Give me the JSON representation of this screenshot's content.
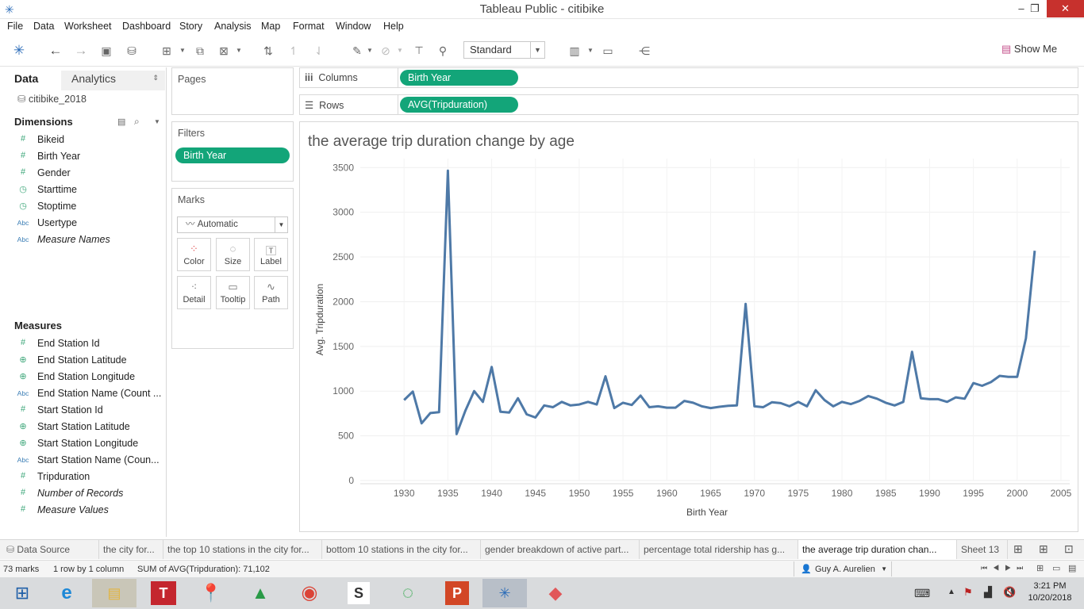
{
  "window": {
    "title": "Tableau Public - citibike"
  },
  "menu": [
    "File",
    "Data",
    "Worksheet",
    "Dashboard",
    "Story",
    "Analysis",
    "Map",
    "Format",
    "Window",
    "Help"
  ],
  "toolbar": {
    "mark_type_select": "Standard",
    "show_me": "Show Me"
  },
  "left_pane": {
    "tabs": [
      "Data",
      "Analytics"
    ],
    "datasource": "citibike_2018",
    "dimensions_header": "Dimensions",
    "dimensions": [
      {
        "label": "Bikeid",
        "icon": "number-icon"
      },
      {
        "label": "Birth Year",
        "icon": "number-icon"
      },
      {
        "label": "Gender",
        "icon": "number-icon"
      },
      {
        "label": "Starttime",
        "icon": "datetime-icon"
      },
      {
        "label": "Stoptime",
        "icon": "datetime-icon"
      },
      {
        "label": "Usertype",
        "icon": "string-icon"
      },
      {
        "label": "Measure Names",
        "icon": "string-icon"
      }
    ],
    "measures_header": "Measures",
    "measures": [
      {
        "label": "End Station Id",
        "icon": "number-icon"
      },
      {
        "label": "End Station Latitude",
        "icon": "globe-icon"
      },
      {
        "label": "End Station Longitude",
        "icon": "globe-icon"
      },
      {
        "label": "End Station Name (Count ...",
        "icon": "string-icon"
      },
      {
        "label": "Start Station Id",
        "icon": "number-icon"
      },
      {
        "label": "Start Station Latitude",
        "icon": "globe-icon"
      },
      {
        "label": "Start Station Longitude",
        "icon": "globe-icon"
      },
      {
        "label": "Start Station Name (Coun...",
        "icon": "string-icon"
      },
      {
        "label": "Tripduration",
        "icon": "number-icon"
      },
      {
        "label": "Number of Records",
        "icon": "number-icon"
      },
      {
        "label": "Measure Values",
        "icon": "number-icon"
      }
    ]
  },
  "cards": {
    "pages": "Pages",
    "filters": "Filters",
    "filter_pill": "Birth Year",
    "marks": "Marks",
    "marks_type": "Automatic",
    "mark_buttons": [
      "Color",
      "Size",
      "Label",
      "Detail",
      "Tooltip",
      "Path"
    ]
  },
  "shelves": {
    "columns_label": "Columns",
    "columns_pill": "Birth Year",
    "rows_label": "Rows",
    "rows_pill": "AVG(Tripduration)"
  },
  "sheet_tabs": [
    "Data Source",
    "the city for...",
    "the top 10 stations in the city for...",
    "bottom 10 stations in the city for...",
    "gender breakdown of active part...",
    "percentage  total ridership has g...",
    "the average trip duration chan...",
    "Sheet 13"
  ],
  "status": {
    "marks": "73 marks",
    "dims": "1 row by 1 column",
    "sum": "SUM of AVG(Tripduration): 71,102",
    "user": "Guy A. Aurelien"
  },
  "taskbar": {
    "time": "3:21 PM",
    "date": "10/20/2018"
  },
  "chart_data": {
    "type": "line",
    "title": "the average trip duration change by age",
    "xlabel": "Birth Year",
    "ylabel": "Avg. Tripduration",
    "xlim": [
      1925,
      2006
    ],
    "ylim": [
      0,
      3600
    ],
    "xticks": [
      1930,
      1935,
      1940,
      1945,
      1950,
      1955,
      1960,
      1965,
      1970,
      1975,
      1980,
      1985,
      1990,
      1995,
      2000,
      2005
    ],
    "yticks": [
      0,
      500,
      1000,
      1500,
      2000,
      2500,
      3000,
      3500
    ],
    "grid": true,
    "color": "#4e79a7",
    "series": [
      {
        "x": [
          1930,
          1931,
          1932,
          1933,
          1934,
          1935,
          1936,
          1937,
          1938,
          1939,
          1940,
          1941,
          1942,
          1943,
          1944,
          1945,
          1946,
          1947,
          1948,
          1949,
          1950,
          1951,
          1952,
          1953,
          1954,
          1955,
          1956,
          1957,
          1958,
          1959,
          1960,
          1961,
          1962,
          1963,
          1964,
          1965,
          1966,
          1967,
          1968,
          1969,
          1970,
          1971,
          1972,
          1973,
          1974,
          1975,
          1976,
          1977,
          1978,
          1979,
          1980,
          1981,
          1982,
          1983,
          1984,
          1985,
          1986,
          1987,
          1988,
          1989,
          1990,
          1991,
          1992,
          1993,
          1994,
          1995,
          1996,
          1997,
          1998,
          1999,
          2000,
          2001,
          2002
        ],
        "y": [
          900,
          995,
          640,
          755,
          765,
          3465,
          520,
          780,
          1000,
          880,
          1270,
          770,
          760,
          920,
          740,
          705,
          840,
          820,
          880,
          840,
          850,
          880,
          850,
          1165,
          810,
          870,
          845,
          950,
          820,
          830,
          815,
          815,
          890,
          870,
          830,
          810,
          825,
          835,
          840,
          1975,
          830,
          820,
          875,
          865,
          830,
          880,
          830,
          1010,
          900,
          830,
          880,
          855,
          890,
          945,
          915,
          870,
          840,
          880,
          1440,
          920,
          910,
          910,
          880,
          930,
          915,
          1090,
          1060,
          1100,
          1170,
          1160,
          1160,
          1590,
          2570
        ]
      }
    ]
  }
}
